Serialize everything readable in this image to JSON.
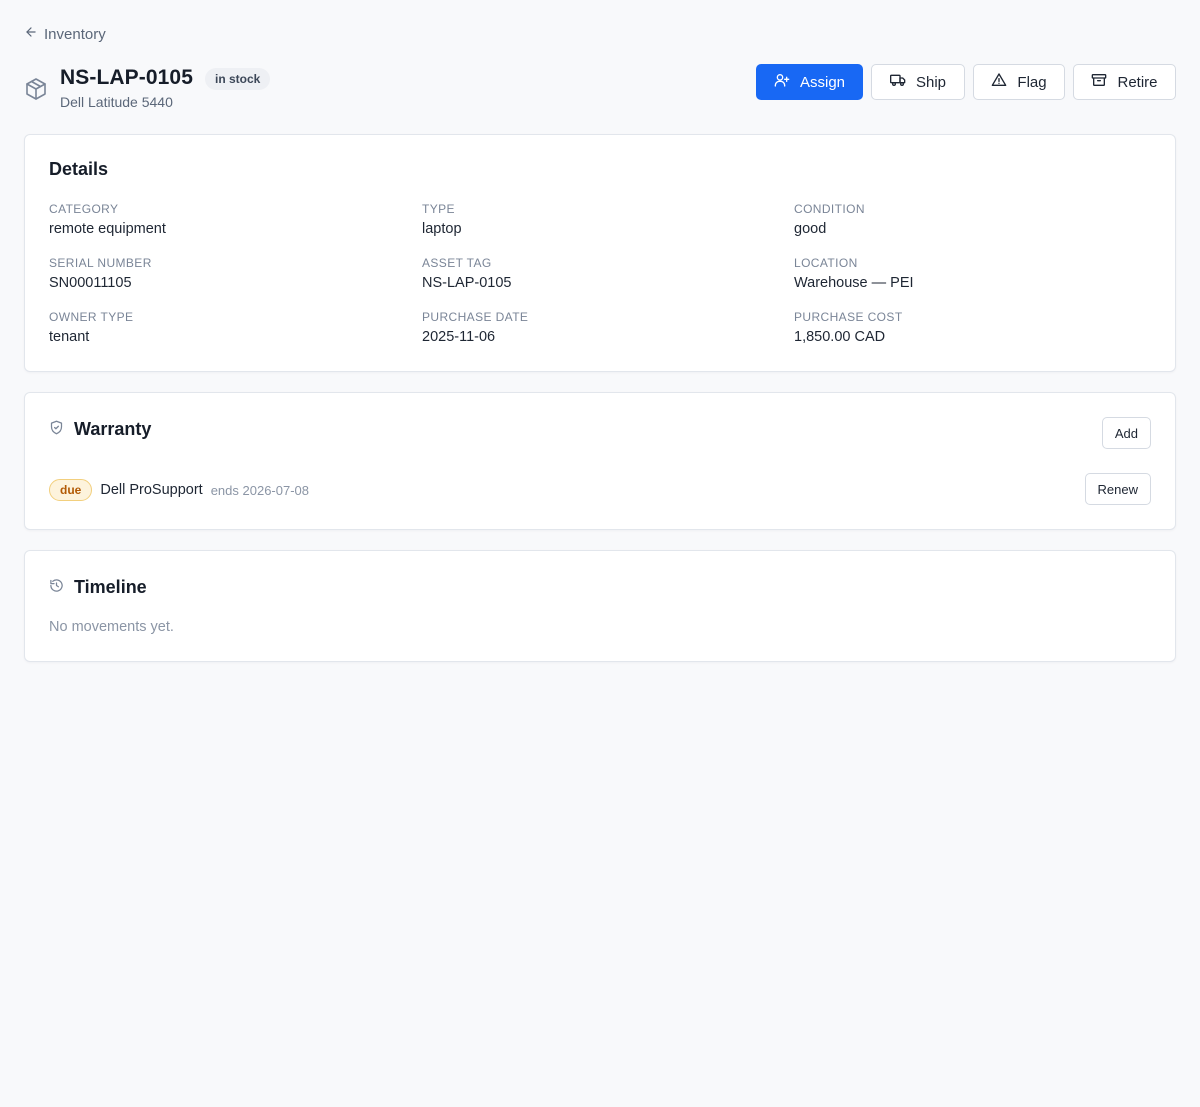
{
  "nav": {
    "back_label": "Inventory"
  },
  "asset": {
    "title": "NS-LAP-0105",
    "status": "in stock",
    "model": "Dell Latitude 5440"
  },
  "actions": {
    "assign": "Assign",
    "ship": "Ship",
    "flag": "Flag",
    "retire": "Retire"
  },
  "details": {
    "title": "Details",
    "fields": [
      {
        "label": "CATEGORY",
        "value": "remote equipment"
      },
      {
        "label": "TYPE",
        "value": "laptop"
      },
      {
        "label": "CONDITION",
        "value": "good"
      },
      {
        "label": "SERIAL NUMBER",
        "value": "SN00011105"
      },
      {
        "label": "ASSET TAG",
        "value": "NS-LAP-0105"
      },
      {
        "label": "LOCATION",
        "value": "Warehouse — PEI"
      },
      {
        "label": "OWNER TYPE",
        "value": "tenant"
      },
      {
        "label": "PURCHASE DATE",
        "value": "2025-11-06"
      },
      {
        "label": "PURCHASE COST",
        "value": "1,850.00 CAD"
      }
    ]
  },
  "warranty": {
    "title": "Warranty",
    "add_label": "Add",
    "items": [
      {
        "badge": "due",
        "name": "Dell ProSupport",
        "ends": "ends 2026-07-08",
        "action": "Renew"
      }
    ]
  },
  "timeline": {
    "title": "Timeline",
    "empty": "No movements yet."
  },
  "colors": {
    "primary": "#1868f4",
    "due_badge_bg": "#fdf3dc",
    "due_badge_text": "#b25a05",
    "status_pill_bg": "#eef0f4"
  },
  "icons": {
    "back": "arrow-left-icon",
    "asset": "package-icon",
    "assign": "user-plus-icon",
    "ship": "truck-icon",
    "flag": "alert-triangle-icon",
    "retire": "archive-icon",
    "warranty": "shield-check-icon",
    "timeline": "history-icon"
  }
}
